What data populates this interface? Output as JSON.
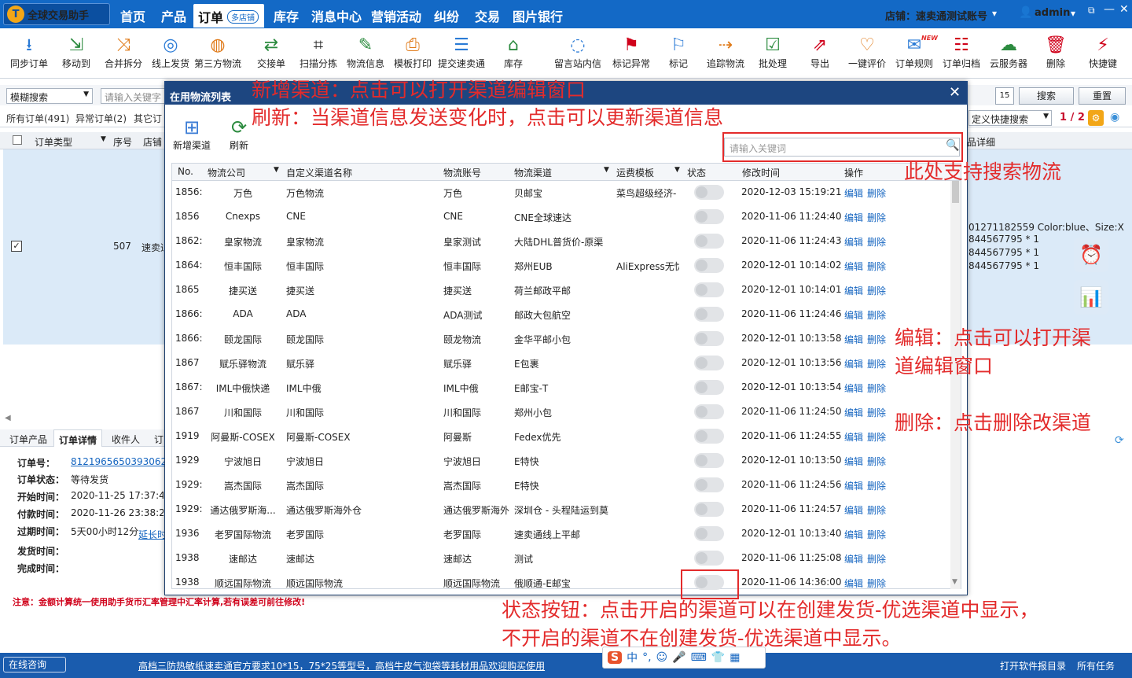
{
  "nav": {
    "brand": "全球交易助手",
    "items": [
      "首页",
      "产品",
      "订单",
      "库存",
      "消息中心",
      "营销活动",
      "纠纷",
      "交易",
      "图片银行"
    ],
    "multi_store": "多店铺",
    "store_label": "店铺：速卖通测试账号",
    "user": "admin"
  },
  "toolbar": [
    "同步订单",
    "移动到",
    "合并拆分",
    "线上发货",
    "第三方物流",
    "交接单",
    "扫描分拣",
    "物流信息",
    "模板打印",
    "提交速卖通",
    "库存",
    "留言站内信",
    "标记异常",
    "标记",
    "追踪物流",
    "批处理",
    "导出",
    "一键评价",
    "订单规则",
    "订单归档",
    "云服务器",
    "删除",
    "快捷键"
  ],
  "toolbar_new_badge": "NEW",
  "filter": {
    "fuzzy": "模糊搜索",
    "keyword_placeholder": "请输入关键字",
    "search": "搜索",
    "reset": "重置",
    "calendar": "15"
  },
  "order_tabs": [
    "所有订单(491)",
    "异常订单(2)",
    "其它订"
  ],
  "quick_search": "定义快捷搜索",
  "pagination": "1 / 2",
  "grid": {
    "headers": [
      "订单类型",
      "序号",
      "店铺"
    ],
    "row": {
      "seq": "507",
      "store": "速卖通"
    },
    "right_header": "品详细",
    "right_lines": [
      "01271182559  Color:blue、Size:X",
      "844567795   * 1",
      "844567795   * 1",
      "844567795   * 1"
    ]
  },
  "detail": {
    "tabs": [
      "订单产品",
      "订单详情",
      "收件人",
      "订"
    ],
    "order_no_label": "订单号：",
    "order_no": "8121965650393062",
    "status_label": "订单状态：",
    "status": "等待发货",
    "start_label": "开始时间：",
    "start": "2020-11-25 17:37:45",
    "pay_label": "付款时间：",
    "pay": "2020-11-26 23:38:28",
    "expire_label": "过期时间：",
    "expire": "5天00小时12分",
    "extend": "延长时",
    "ship_label": "发货时间：",
    "done_label": "完成时间："
  },
  "notice": "注意：金额计算统一使用助手货币汇率管理中汇率计算,若有误差可前往修改!",
  "statusbar": {
    "consult": "在线咨询",
    "marquee": "高档三防热敏纸速卖通官方要求10*15，75*25等型号，高档牛皮气泡袋等耗材用品欢迎购买使用",
    "log_dir": "打开软件报目录",
    "all_tasks": "所有任务",
    "ime": "中"
  },
  "modal": {
    "title": "在用物流列表",
    "tools": [
      "新增渠道",
      "刷新"
    ],
    "search_placeholder": "请输入关键词",
    "headers": [
      "No.",
      "物流公司",
      "自定义渠道名称",
      "物流账号",
      "物流渠道",
      "运费模板",
      "状态",
      "修改时间",
      "操作"
    ],
    "edit": "编辑",
    "delete": "删除",
    "rows": [
      [
        "1856:",
        "万色",
        "万色物流",
        "万色",
        "贝邮宝",
        "菜鸟超级经济-",
        "2020-12-03 15:19:21"
      ],
      [
        "1856",
        "Cnexps",
        "CNE",
        "CNE",
        "CNE全球速达",
        "",
        "2020-11-06 11:24:40"
      ],
      [
        "1862:",
        "皇家物流",
        "皇家物流",
        "皇家测试",
        "大陆DHL普货价-原渠",
        "",
        "2020-11-06 11:24:43"
      ],
      [
        "1864:",
        "恒丰国际",
        "恒丰国际",
        "恒丰国际",
        "郑州EUB",
        "AliExpress无忧",
        "2020-12-01 10:14:02"
      ],
      [
        "1865",
        "捷买送",
        "捷买送",
        "捷买送",
        "荷兰邮政平邮",
        "",
        "2020-12-01 10:14:01"
      ],
      [
        "1866:",
        "ADA",
        "ADA",
        "ADA测试",
        "邮政大包航空",
        "",
        "2020-11-06 11:24:46"
      ],
      [
        "1866:",
        "颐龙国际",
        "颐龙国际",
        "颐龙物流",
        "金华平邮小包",
        "",
        "2020-12-01 10:13:58"
      ],
      [
        "1867",
        "赋乐驿物流",
        "赋乐驿",
        "赋乐驿",
        "E包裹",
        "",
        "2020-12-01 10:13:56"
      ],
      [
        "1867:",
        "IML中俄快递",
        "IML中俄",
        "IML中俄",
        "E邮宝-T",
        "",
        "2020-12-01 10:13:54"
      ],
      [
        "1867",
        "川和国际",
        "川和国际",
        "川和国际",
        "郑州小包",
        "",
        "2020-11-06 11:24:50"
      ],
      [
        "1919",
        "阿曼斯-COSEX",
        "阿曼斯-COSEX",
        "阿曼斯",
        "Fedex优先",
        "",
        "2020-11-06 11:24:55"
      ],
      [
        "1929",
        "宁波旭日",
        "宁波旭日",
        "宁波旭日",
        "E特快",
        "",
        "2020-12-01 10:13:50"
      ],
      [
        "1929:",
        "嵩杰国际",
        "嵩杰国际",
        "嵩杰国际",
        "E特快",
        "",
        "2020-11-06 11:24:56"
      ],
      [
        "1929:",
        "通达俄罗斯海...",
        "通达俄罗斯海外仓",
        "通达俄罗斯海外",
        "深圳仓 - 头程陆运到莫",
        "",
        "2020-11-06 11:24:57"
      ],
      [
        "1936",
        "老罗国际物流",
        "老罗国际",
        "老罗国际",
        "速卖通线上平邮",
        "",
        "2020-12-01 10:13:40"
      ],
      [
        "1938",
        "速邮达",
        "速邮达",
        "速邮达",
        "测试",
        "",
        "2020-11-06 11:25:08"
      ],
      [
        "1938",
        "顺远国际物流",
        "顺远国际物流",
        "顺远国际物流",
        "俄顺通-E邮宝",
        "",
        "2020-11-06 14:36:00"
      ]
    ]
  },
  "annotations": {
    "add": "新增渠道：点击可以打开渠道编辑窗口",
    "refresh": "刷新：当渠道信息发送变化时，点击可以更新渠道信息",
    "search": "此处支持搜索物流",
    "edit_1": "编辑：点击可以打开渠",
    "edit_2": "道编辑窗口",
    "delete": "删除：点击删除改渠道",
    "status_1": "状态按钮：点击开启的渠道可以在创建发货-优选渠道中显示，",
    "status_2": "不开启的渠道不在创建发货-优选渠道中显示。"
  }
}
